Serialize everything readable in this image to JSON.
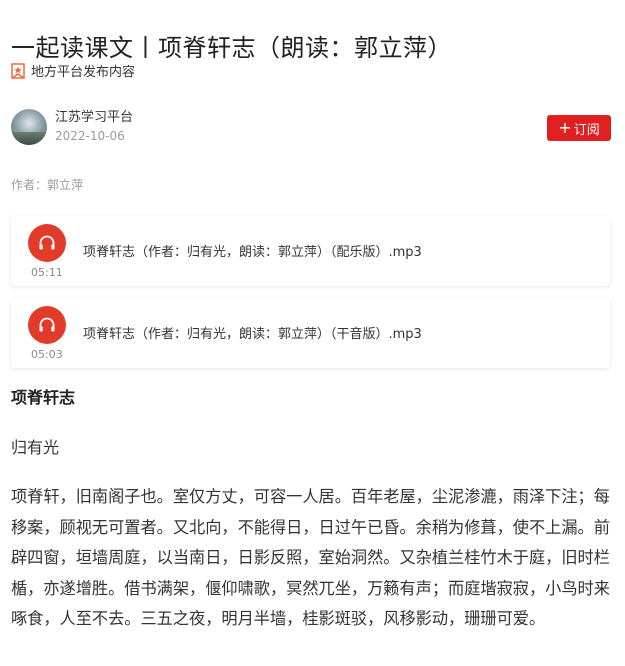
{
  "article": {
    "title": "一起读课文丨项脊轩志（朗读：郭立萍）",
    "local_tag": "地方平台发布内容",
    "source_name": "江苏学习平台",
    "date": "2022-10-06",
    "subscribe_label": "订阅",
    "author_line": "作者：郭立萍"
  },
  "audio": [
    {
      "title": "项脊轩志（作者：归有光，朗读：郭立萍）（配乐版）.mp3",
      "duration": "05:11"
    },
    {
      "title": "项脊轩志（作者：归有光，朗读：郭立萍）（干音版）.mp3",
      "duration": "05:03"
    }
  ],
  "content": {
    "section_title": "项脊轩志",
    "author": "归有光",
    "paragraph": "项脊轩，旧南阁子也。室仅方丈，可容一人居。百年老屋，尘泥渗漉，雨泽下注；每移案，顾视无可置者。又北向，不能得日，日过午已昏。余稍为修葺，使不上漏。前辟四窗，垣墙周庭，以当南日，日影反照，室始洞然。又杂植兰桂竹木于庭，旧时栏楯，亦遂增胜。借书满架，偃仰啸歌，冥然兀坐，万籁有声；而庭堦寂寂，小鸟时来啄食，人至不去。三五之夜，明月半墙，桂影斑驳，风移影动，珊珊可爱。"
  },
  "colors": {
    "accent": "#e02020",
    "play": "#e23b2a",
    "muted": "#9a9a9a"
  },
  "icons": {
    "local_badge": "ribbon-badge-icon",
    "play": "headphones-icon"
  }
}
